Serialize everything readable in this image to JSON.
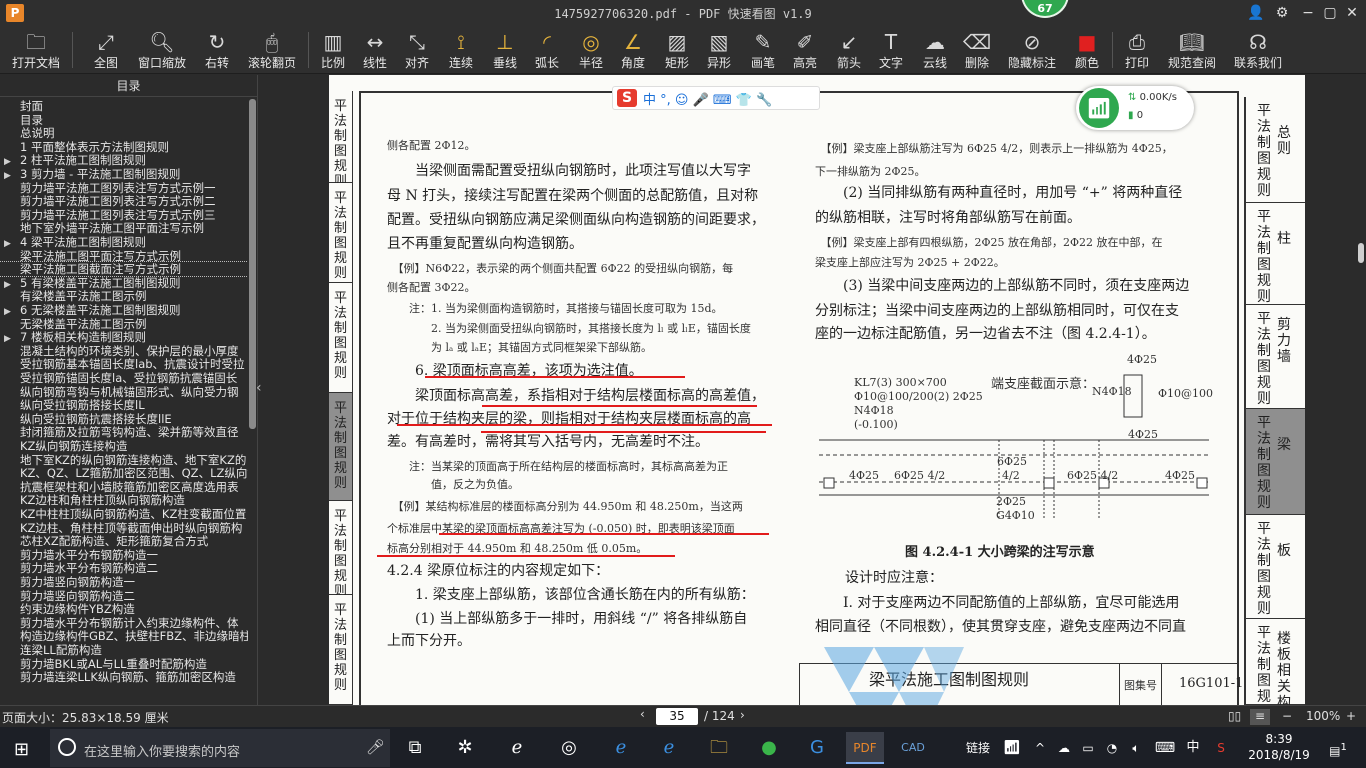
{
  "titlebar": {
    "title": "1475927706320.pdf - PDF 快速看图 v1.9",
    "badge": "67"
  },
  "toolbar": {
    "items": [
      {
        "label": "打开文档",
        "icon": "folder-icon"
      },
      {
        "label": "全图",
        "icon": "expand-icon"
      },
      {
        "label": "窗口缩放",
        "icon": "magnifier-icon"
      },
      {
        "label": "右转",
        "icon": "rotate-right-icon"
      },
      {
        "label": "滚轮翻页",
        "icon": "mouse-icon"
      },
      {
        "label": "比例",
        "icon": "scale-ruler-icon"
      },
      {
        "label": "线性",
        "icon": "linear-measure-icon"
      },
      {
        "label": "对齐",
        "icon": "aligned-measure-icon"
      },
      {
        "label": "连续",
        "icon": "continuous-measure-icon"
      },
      {
        "label": "垂线",
        "icon": "perpendicular-icon"
      },
      {
        "label": "弧长",
        "icon": "arc-length-icon"
      },
      {
        "label": "半径",
        "icon": "radius-icon"
      },
      {
        "label": "角度",
        "icon": "angle-icon"
      },
      {
        "label": "矩形",
        "icon": "rectangle-area-icon"
      },
      {
        "label": "异形",
        "icon": "polygon-area-icon"
      },
      {
        "label": "画笔",
        "icon": "pen-icon"
      },
      {
        "label": "高亮",
        "icon": "highlighter-icon"
      },
      {
        "label": "箭头",
        "icon": "arrow-icon"
      },
      {
        "label": "文字",
        "icon": "text-icon"
      },
      {
        "label": "云线",
        "icon": "cloud-line-icon"
      },
      {
        "label": "删除",
        "icon": "eraser-icon"
      },
      {
        "label": "隐藏标注",
        "icon": "hide-eye-icon"
      },
      {
        "label": "颜色",
        "icon": "color-swatch-icon"
      },
      {
        "label": "打印",
        "icon": "printer-icon"
      },
      {
        "label": "规范查阅",
        "icon": "book-icon"
      },
      {
        "label": "联系我们",
        "icon": "headset-icon"
      }
    ],
    "color_swatch": "#e21b1b"
  },
  "sidebar": {
    "title": "目录",
    "items": [
      {
        "label": "封面",
        "arrow": ""
      },
      {
        "label": "目录",
        "arrow": ""
      },
      {
        "label": "总说明",
        "arrow": ""
      },
      {
        "label": "1  平面整体表示方法制图规则",
        "arrow": ""
      },
      {
        "label": "2  柱平法施工图制图规则",
        "arrow": "▶"
      },
      {
        "label": "3  剪力墙 - 平法施工图制图规则",
        "arrow": "▶"
      },
      {
        "label": "剪力墙平法施工图列表注写方式示例一",
        "arrow": ""
      },
      {
        "label": "剪力墙平法施工图列表注写方式示例二",
        "arrow": ""
      },
      {
        "label": "剪力墙平法施工图列表注写方式示例三",
        "arrow": ""
      },
      {
        "label": "地下室外墙平法施工图平面注写示例",
        "arrow": ""
      },
      {
        "label": "4  梁平法施工图制图规则",
        "arrow": "▶"
      },
      {
        "label": "梁平法施工图平面注写方式示例",
        "arrow": ""
      },
      {
        "label": "梁平法施工图截面注写方式示例",
        "arrow": "",
        "selected": true
      },
      {
        "label": "5  有梁楼盖平法施工图制图规则",
        "arrow": "▶"
      },
      {
        "label": "有梁楼盖平法施工图示例",
        "arrow": ""
      },
      {
        "label": "6  无梁楼盖平法施工图制图规则",
        "arrow": "▶"
      },
      {
        "label": "无梁楼盖平法施工图示例",
        "arrow": ""
      },
      {
        "label": "7  楼板相关构造制图规则",
        "arrow": "▶"
      },
      {
        "label": "混凝土结构的环境类别、保护层的最小厚度",
        "arrow": ""
      },
      {
        "label": "受拉钢筋基本锚固长度lab、抗震设计时受拉",
        "arrow": ""
      },
      {
        "label": "受拉钢筋锚固长度la、受拉钢筋抗震锚固长",
        "arrow": ""
      },
      {
        "label": "纵向钢筋弯钩与机械锚固形式、纵向受力钢",
        "arrow": ""
      },
      {
        "label": "纵向受拉钢筋搭接长度lL",
        "arrow": ""
      },
      {
        "label": "纵向受拉钢筋抗震搭接长度llE",
        "arrow": ""
      },
      {
        "label": "封闭箍筋及拉筋弯钩构造、梁并筋等效直径",
        "arrow": ""
      },
      {
        "label": "KZ纵向钢筋连接构造",
        "arrow": ""
      },
      {
        "label": "地下室KZ的纵向钢筋连接构造、地下室KZ的",
        "arrow": ""
      },
      {
        "label": "KZ、QZ、LZ箍筋加密区范围、QZ、LZ纵向钢",
        "arrow": ""
      },
      {
        "label": "抗震框架柱和小墙肢箍筋加密区高度选用表",
        "arrow": ""
      },
      {
        "label": "KZ边柱和角柱柱顶纵向钢筋构造",
        "arrow": ""
      },
      {
        "label": "KZ中柱柱顶纵向钢筋构造、KZ柱变截面位置",
        "arrow": ""
      },
      {
        "label": "KZ边柱、角柱柱顶等截面伸出时纵向钢筋构",
        "arrow": ""
      },
      {
        "label": "芯柱XZ配筋构造、矩形箍筋复合方式",
        "arrow": ""
      },
      {
        "label": "剪力墙水平分布钢筋构造一",
        "arrow": ""
      },
      {
        "label": "剪力墙水平分布钢筋构造二",
        "arrow": ""
      },
      {
        "label": "剪力墙竖向钢筋构造一",
        "arrow": ""
      },
      {
        "label": "剪力墙竖向钢筋构造二",
        "arrow": ""
      },
      {
        "label": "约束边缘构件YBZ构造",
        "arrow": ""
      },
      {
        "label": "剪力墙水平分布钢筋计入约束边缘构件、体",
        "arrow": ""
      },
      {
        "label": "构造边缘构件GBZ、扶壁柱FBZ、非边缘暗柱",
        "arrow": ""
      },
      {
        "label": "连梁LL配筋构造",
        "arrow": ""
      },
      {
        "label": "剪力墙BKL或AL与LL重叠时配筋构造",
        "arrow": ""
      },
      {
        "label": "剪力墙连梁LLK纵向钢筋、箍筋加密区构造",
        "arrow": ""
      }
    ]
  },
  "ime": {
    "logo": "S",
    "icons": "中 °, ☺ 🎤 ⌨ 👕 🔧"
  },
  "network": {
    "speed": "0.00K/s",
    "count": "0"
  },
  "page": {
    "left_tabs": [
      "平法制图规则",
      "平法制图规则",
      "平法制图规则",
      "平法制图规则",
      "平法制图规则",
      "平法制图规则"
    ],
    "right_tabs": [
      {
        "a": "平法制图规则",
        "b": "总则"
      },
      {
        "a": "平法制图规则",
        "b": "柱"
      },
      {
        "a": "平法制图规则",
        "b": "剪力墙"
      },
      {
        "a": "平法制图规则",
        "b": "梁",
        "active": true
      },
      {
        "a": "平法制图规则",
        "b": "板"
      },
      {
        "a": "平法制图规则",
        "b": "楼板相关构造"
      }
    ],
    "left_col": [
      "侧各配置 2Φ12。",
      "　　当梁侧面需配置受扭纵向钢筋时，此项注写值以大写字",
      "母 N 打头，接续注写配置在梁两个侧面的总配筋值，且对称",
      "配置。受扭纵向钢筋应满足梁侧面纵向构造钢筋的间距要求，",
      "且不再重复配置纵向构造钢筋。",
      "　【例】N6Φ22，表示梁的两个侧面共配置 6Φ22 的受扭纵向钢筋，每",
      "侧各配置 3Φ22。",
      "　　注：1. 当为梁侧面构造钢筋时，其搭接与锚固长度可取为 15d。",
      "　　　　2. 当为梁侧面受扭纵向钢筋时，其搭接长度为 lₗ 或 lₗE，锚固长度",
      "　　　　为 lₐ 或 lₐE；其锚固方式同框架梁下部纵筋。",
      "　　6. 梁顶面标高高差，该项为选注值。",
      "　　梁顶面标高高差，系指相对于结构层楼面标高的高差值，",
      "对于位于结构夹层的梁，则指相对于结构夹层楼面标高的高",
      "差。有高差时，需将其写入括号内，无高差时不注。",
      "　　注：当某梁的顶面高于所在结构层的楼面标高时，其标高高差为正",
      "　　　　值，反之为负值。",
      "　【例】某结构标准层的楼面标高分别为 44.950m 和 48.250m，当这两",
      "个标准层中某梁的梁顶面标高高差注写为 (-0.050) 时，即表明该梁顶面",
      "标高分别相对于 44.950m 和 48.250m 低 0.05m。",
      "4.2.4  梁原位标注的内容规定如下：",
      "　　1. 梁支座上部纵筋，该部位含通长筋在内的所有纵筋：",
      "　　(1) 当上部纵筋多于一排时，用斜线 “/” 将各排纵筋自",
      "上而下分开。"
    ],
    "right_col": [
      "　【例】梁支座上部纵筋注写为 6Φ25 4/2，则表示上一排纵筋为 4Φ25，",
      "下一排纵筋为 2Φ25。",
      "　　(2) 当同排纵筋有两种直径时，用加号 “+” 将两种直径",
      "的纵筋相联，注写时将角部纵筋写在前面。",
      "　【例】梁支座上部有四根纵筋，2Φ25 放在角部，2Φ22 放在中部，在",
      "梁支座上部应注写为 2Φ25 + 2Φ22。",
      "　　(3) 当梁中间支座两边的上部纵筋不同时，须在支座两边",
      "分别标注；当梁中间支座两边的上部纵筋相同时，可仅在支",
      "座的一边标注配筋值，另一边省去不注（图 4.2.4-1）。"
    ],
    "figure": {
      "label_section": "端支座截面示意：",
      "kl": "KL7(3)  300×700",
      "kl2": "Φ10@100/200(2)  2Φ25",
      "kl3": "N4Φ18",
      "kl4": "(-0.100)",
      "top1": "4Φ25",
      "n4": "N4Φ18",
      "stirrup": "Φ10@100",
      "bot1": "4Φ25",
      "span_a": "4Φ25",
      "span_b": "6Φ25 4/2",
      "span_c": "6Φ25",
      "span_c2": "4/2",
      "span_d": "6Φ25 4/2",
      "span_e": "4Φ25",
      "mid_bot": "2Φ25",
      "g4": "G4Φ10",
      "caption": "图 4.2.4-1  大小跨梁的注写示意"
    },
    "design_note_title": "设计时应注意：",
    "design_note_1": "　　Ⅰ. 对于支座两边不同配筋值的上部纵筋，宜尽可能选用",
    "design_note_2": "相同直径（不同根数），使其贯穿支座，避免支座两边不同直",
    "footer_title": "梁平法施工图制图规则",
    "footer_label": "图集号",
    "footer_code": "16G101-1"
  },
  "status": {
    "page_size": "页面大小：25.83×18.59 厘米",
    "current_page": "35",
    "total_pages": "/ 124",
    "zoom": "100%"
  },
  "taskbar": {
    "search_placeholder": "在这里输入你要搜索的内容",
    "tray_link": "链接",
    "ime_lang": "中",
    "time": "8:39",
    "date": "2018/8/19",
    "notifications": "1"
  }
}
